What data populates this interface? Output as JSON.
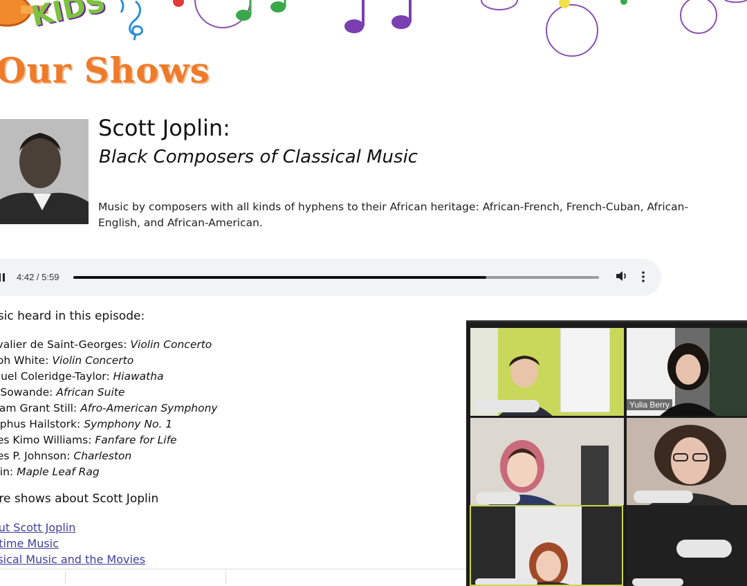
{
  "site": {
    "logo_text": "FOR KIDS",
    "page_heading": "Our Shows"
  },
  "show": {
    "title": "Scott Joplin:",
    "subtitle": "Black Composers of Classical Music",
    "description": "Music by composers with all kinds of hyphens to their African heritage: African-French, French-Cuban, African-English, and African-American."
  },
  "audio_player": {
    "time_display": "4:42 / 5:59",
    "progress": 0.785,
    "icons": [
      "pause-icon",
      "volume-icon",
      "more-options-icon"
    ]
  },
  "music_section": {
    "heading": "usic heard in this episode:",
    "items": [
      {
        "composer": "evalier de Saint-Georges: ",
        "work": "Violin Concerto"
      },
      {
        "composer": "eph White: ",
        "work": "Violin Concerto"
      },
      {
        "composer": "muel Coleridge-Taylor: ",
        "work": "Hiawatha"
      },
      {
        "composer": "a Sowande: ",
        "work": "African Suite"
      },
      {
        "composer": "lliam Grant Still: ",
        "work": "Afro-American Symphony"
      },
      {
        "composer": "olphus Hailstork: ",
        "work": "Symphony No. 1"
      },
      {
        "composer": "nes Kimo Williams: ",
        "work": "Fanfare for Life"
      },
      {
        "composer": "nes P. Johnson: ",
        "work": "Charleston"
      },
      {
        "composer": "olin: ",
        "work": "Maple Leaf Rag"
      }
    ]
  },
  "more_section": {
    "heading": "ore shows about Scott Joplin",
    "links": [
      "out Scott Joplin",
      "gtime Music",
      "ssical Music and the Movies"
    ]
  },
  "video_call": {
    "participant_name": "Yulia Berry",
    "active_speaker_color": "#c8d64a"
  },
  "colors": {
    "heading_orange": "#ee7b2a",
    "logo_green": "#7dc242",
    "note_purple": "#8a4fb0",
    "note_green": "#3aa84a",
    "link_blue": "#3e3e9e",
    "player_bg": "#f1f3f4"
  }
}
